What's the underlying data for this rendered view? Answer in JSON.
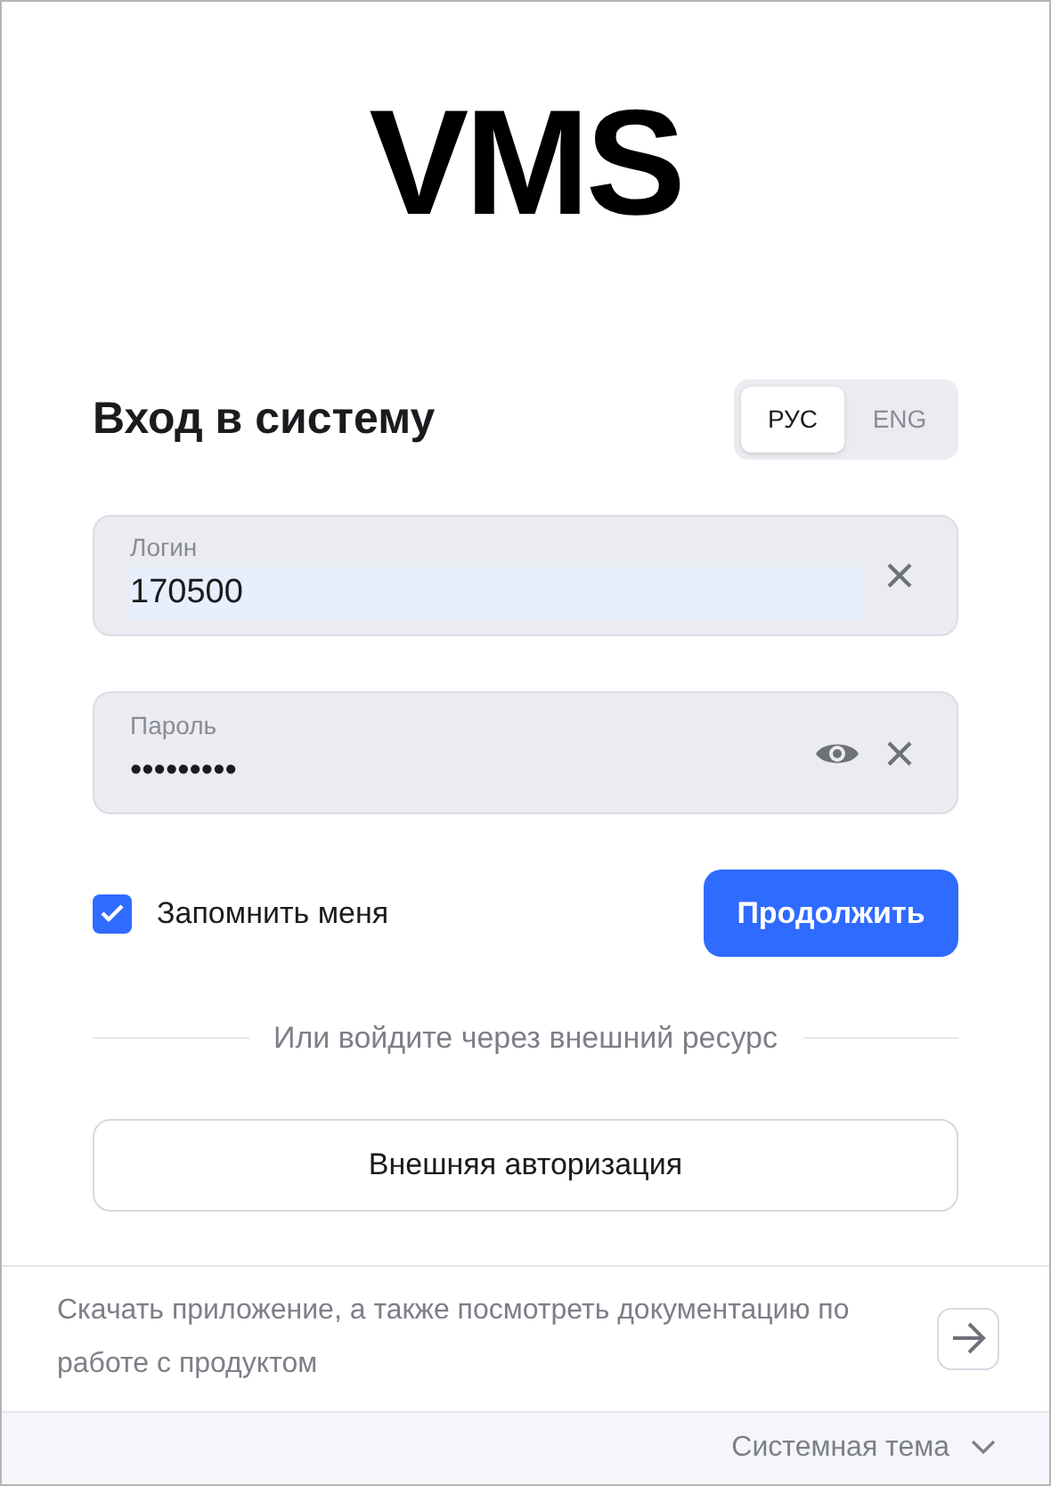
{
  "logo": "VMS",
  "heading": "Вход в систему",
  "languages": [
    {
      "label": "РУС",
      "selected": true
    },
    {
      "label": "ENG",
      "selected": false
    }
  ],
  "login": {
    "label": "Логин",
    "value": "170500"
  },
  "password": {
    "label": "Пароль",
    "value": "•••••••••"
  },
  "remember": {
    "label": "Запомнить меня",
    "checked": true
  },
  "submit": "Продолжить",
  "divider": "Или войдите через внешний ресурс",
  "external_button": "Внешняя авторизация",
  "footer_text": "Скачать приложение, а также посмотреть документацию по работе с продуктом",
  "theme": "Системная тема"
}
